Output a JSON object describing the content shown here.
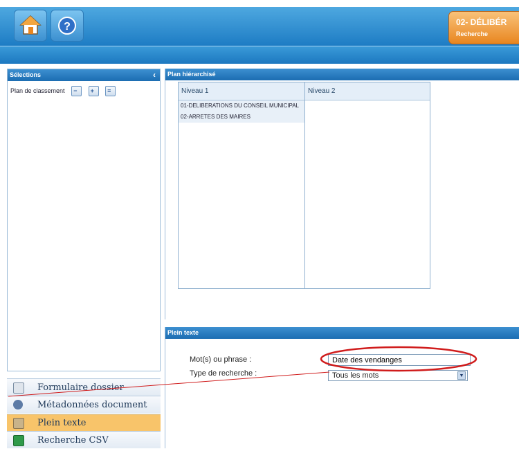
{
  "header": {
    "module_title": "02- DÉLIBÉR",
    "module_subtitle": "Recherche",
    "accent_color": "#1d7cc4",
    "orange_color": "#e8861f"
  },
  "toolbar": {
    "home_icon": "home-icon",
    "help_icon": "help-icon",
    "help_glyph": "?"
  },
  "selections": {
    "title": "Sélections",
    "collapse_glyph": "‹",
    "plan_label": "Plan de classement",
    "icons": [
      "collapse-all-icon",
      "expand-all-icon",
      "list-view-icon"
    ]
  },
  "plan": {
    "title": "Plan hiérarchisé",
    "col1_header": "Niveau 1",
    "col2_header": "Niveau 2",
    "rows": [
      "01-DELIBERATIONS DU CONSEIL MUNICIPAL",
      "02-ARRETES DES MAIRES"
    ]
  },
  "fulltext": {
    "title": "Plein texte",
    "words_label": "Mot(s) ou phrase :",
    "words_value": "Date des vendanges",
    "type_label": "Type de recherche :",
    "type_value": "Tous les mots"
  },
  "nav": [
    {
      "label": "Formulaire dossier",
      "icon": "form-icon",
      "active": false
    },
    {
      "label": "Métadonnées document",
      "icon": "metadata-icon",
      "active": false
    },
    {
      "label": "Plein texte",
      "icon": "fulltext-icon",
      "active": true
    },
    {
      "label": "Recherche CSV",
      "icon": "csv-icon",
      "active": false
    }
  ],
  "annotation_color": "#d01c1c"
}
